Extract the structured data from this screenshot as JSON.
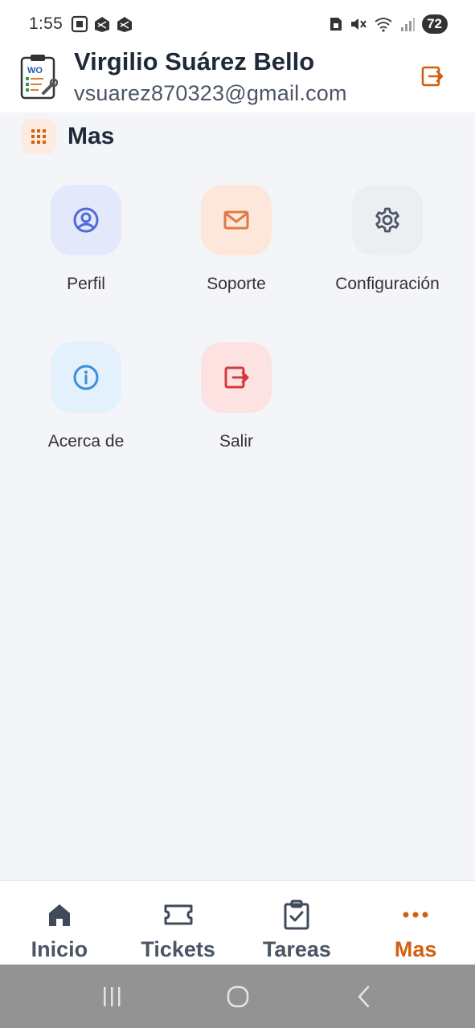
{
  "status_bar": {
    "time": "1:55",
    "battery_level": "72",
    "left_icons": [
      "screenshot-icon",
      "app-notification-icon",
      "app-notification-icon"
    ],
    "right_icons": [
      "sim-icon",
      "mute-icon",
      "wifi-icon",
      "signal-icon",
      "battery-icon"
    ]
  },
  "header": {
    "logo_text": "WO",
    "user_name": "Virgilio Suárez Bello",
    "user_email": "vsuarez870323@gmail.com",
    "logout_icon": "logout-icon"
  },
  "section": {
    "title": "Mas",
    "icon": "grid-icon"
  },
  "menu": {
    "items": [
      {
        "label": "Perfil",
        "icon": "user-circle-icon",
        "bg": "#e3e8fb",
        "color": "#4f6bd8"
      },
      {
        "label": "Soporte",
        "icon": "mail-icon",
        "bg": "#fde6da",
        "color": "#e07a45"
      },
      {
        "label": "Configuración",
        "icon": "gear-icon",
        "bg": "#eceef2",
        "color": "#4b5563"
      },
      {
        "label": "Acerca de",
        "icon": "info-icon",
        "bg": "#e2f1fc",
        "color": "#3b8fd9"
      },
      {
        "label": "Salir",
        "icon": "logout-icon",
        "bg": "#fde2e2",
        "color": "#d23b3b"
      }
    ]
  },
  "bottom_nav": {
    "items": [
      {
        "label": "Inicio",
        "icon": "home-icon",
        "active": false
      },
      {
        "label": "Tickets",
        "icon": "ticket-icon",
        "active": false
      },
      {
        "label": "Tareas",
        "icon": "clipboard-check-icon",
        "active": false
      },
      {
        "label": "Mas",
        "icon": "more-dots-icon",
        "active": true
      }
    ]
  },
  "colors": {
    "accent": "#d35f11",
    "background": "#f4f5f9",
    "nav_inactive": "#4b5563"
  }
}
